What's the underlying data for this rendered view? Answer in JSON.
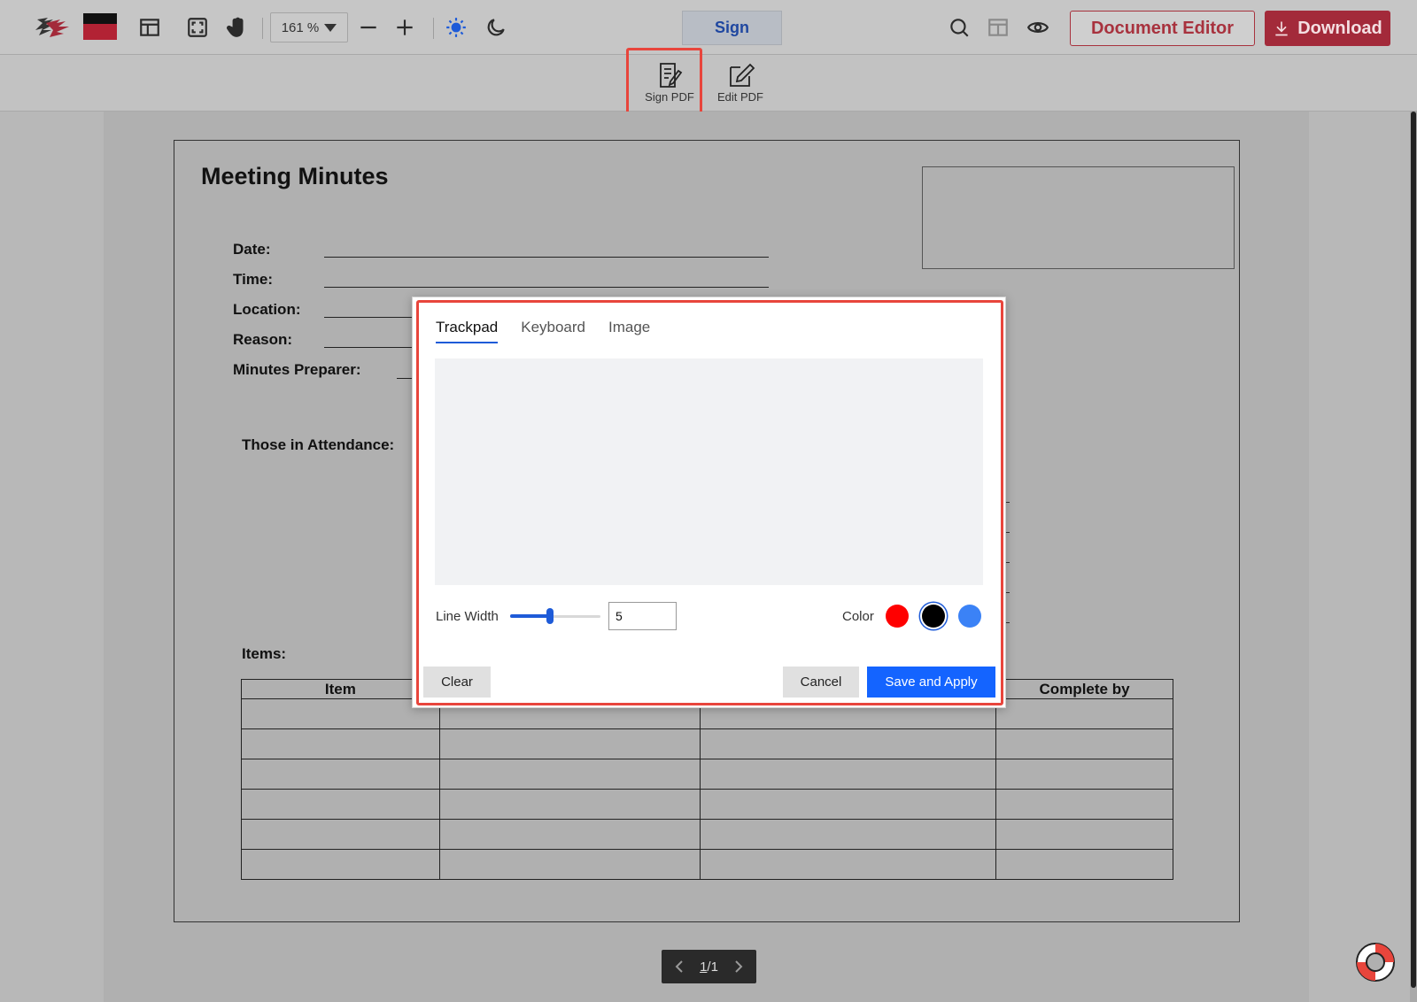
{
  "toolbar": {
    "zoom_value": "161 %",
    "sign_tab_label": "Sign",
    "document_editor_label": "Document Editor",
    "download_label": "Download",
    "accent_color": "#a32a3a",
    "icons": [
      "logo",
      "layout-icon",
      "fullscreen-icon",
      "hand-icon",
      "zoom-out-icon",
      "zoom-in-icon",
      "light-mode-icon",
      "dark-mode-icon",
      "search-icon",
      "split-view-icon",
      "eye-icon",
      "download-icon"
    ]
  },
  "subtoolbar": {
    "sign_pdf_label": "Sign PDF",
    "edit_pdf_label": "Edit PDF"
  },
  "document": {
    "title": "Meeting Minutes",
    "fields": [
      "Date:",
      "Time:",
      "Location:",
      "Reason:",
      "Minutes Preparer:"
    ],
    "attendance_label": "Those in Attendance:",
    "items_label": "Items:",
    "table_headers": [
      "Item",
      "",
      "",
      "Complete by"
    ],
    "table_row_count": 6
  },
  "pager": {
    "current_page": "1",
    "total_pages": "1"
  },
  "signature_modal": {
    "tabs": [
      "Trackpad",
      "Keyboard",
      "Image"
    ],
    "active_tab": "Trackpad",
    "line_width_label": "Line Width",
    "line_width_value": "5",
    "line_width_fraction": 0.44,
    "color_label": "Color",
    "colors": [
      {
        "name": "red",
        "hex": "#ff0000",
        "selected": false
      },
      {
        "name": "black",
        "hex": "#000000",
        "selected": true
      },
      {
        "name": "blue",
        "hex": "#3b82f6",
        "selected": false
      }
    ],
    "clear_label": "Clear",
    "cancel_label": "Cancel",
    "save_label": "Save and Apply"
  }
}
